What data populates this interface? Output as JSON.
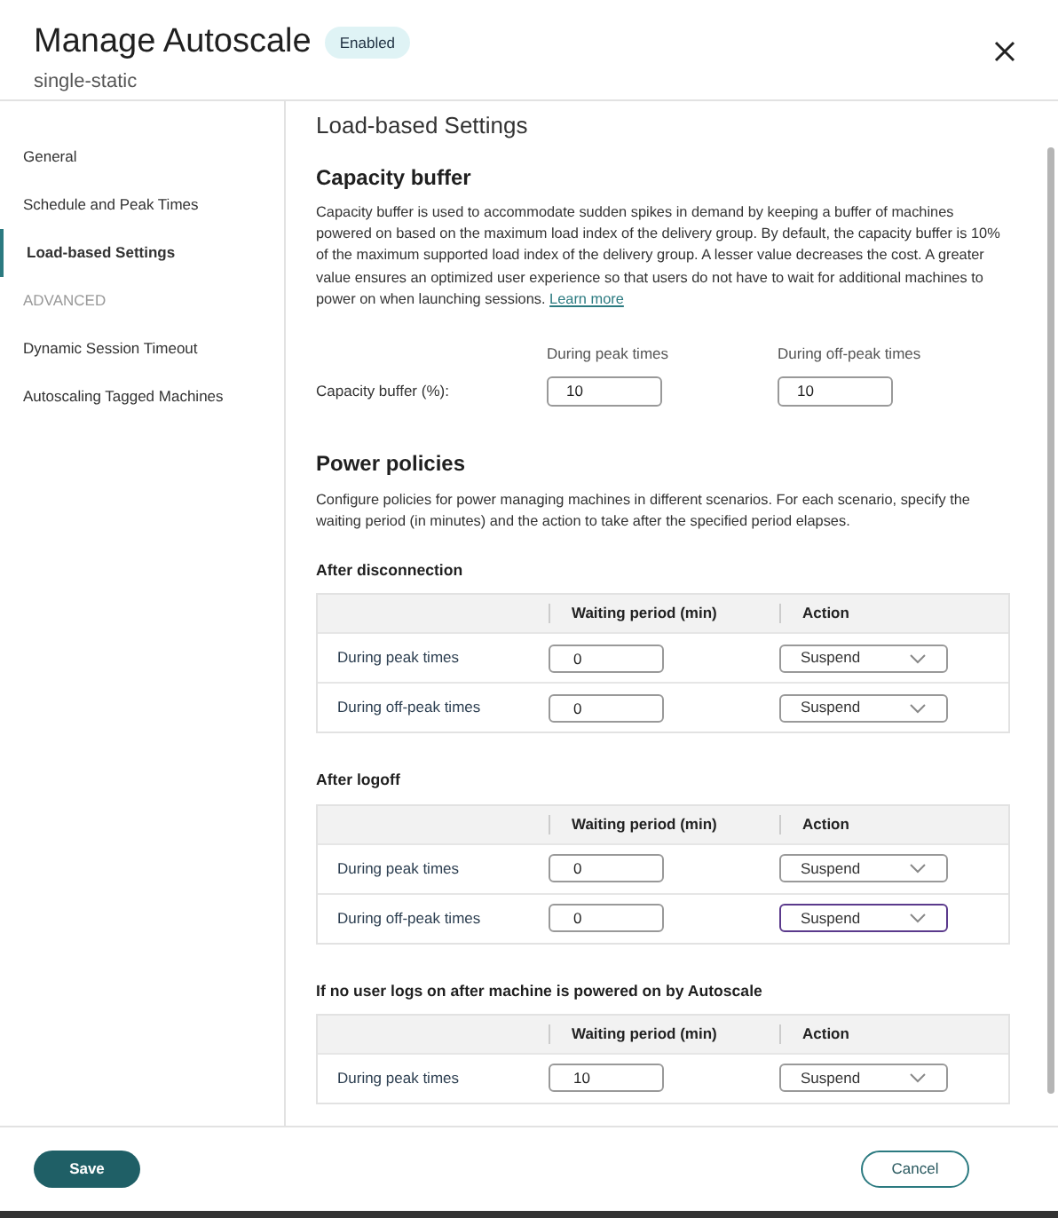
{
  "header": {
    "title": "Manage Autoscale",
    "badge": "Enabled",
    "subtitle": "single-static"
  },
  "sidebar": {
    "items": [
      {
        "label": "General",
        "kind": "link",
        "selected": false
      },
      {
        "label": "Schedule and Peak Times",
        "kind": "link",
        "selected": false
      },
      {
        "label": "Load-based Settings",
        "kind": "link",
        "selected": true
      },
      {
        "label": "ADVANCED",
        "kind": "heading",
        "selected": false
      },
      {
        "label": "Dynamic Session Timeout",
        "kind": "link",
        "selected": false
      },
      {
        "label": "Autoscaling Tagged Machines",
        "kind": "link",
        "selected": false
      }
    ]
  },
  "content": {
    "page_title": "Load-based Settings",
    "capacity_buffer": {
      "title": "Capacity buffer",
      "description": "Capacity buffer is used to accommodate sudden spikes in demand by keeping a buffer of machines powered on based on the maximum load index of the delivery group. By default, the capacity buffer is 10% of the maximum supported load index of the delivery group. A lesser value decreases the cost. A greater value ensures an optimized user experience so that users do not have to wait for additional machines to power on when launching sessions.",
      "link": "Learn more",
      "columns": [
        "During peak times",
        "During off-peak times"
      ],
      "field_label": "Capacity buffer (%):",
      "values": [
        "10",
        "10"
      ]
    },
    "power_policies": {
      "title": "Power policies",
      "description": "Configure policies for power managing machines in different scenarios. For each scenario, specify the waiting period (in minutes) and the action to take after the specified period elapses.",
      "sections": [
        {
          "title": "After disconnection",
          "columns": [
            "Waiting period (min)",
            "Action"
          ],
          "rows": [
            {
              "label": "During peak times",
              "wait": "0",
              "action": "Suspend",
              "focused": false
            },
            {
              "label": "During off-peak times",
              "wait": "0",
              "action": "Suspend",
              "focused": false
            }
          ]
        },
        {
          "title": "After logoff",
          "columns": [
            "Waiting period (min)",
            "Action"
          ],
          "rows": [
            {
              "label": "During peak times",
              "wait": "0",
              "action": "Suspend",
              "focused": false
            },
            {
              "label": "During off-peak times",
              "wait": "0",
              "action": "Suspend",
              "focused": true
            }
          ]
        },
        {
          "title": "If no user logs on after machine is powered on by Autoscale",
          "columns": [
            "Waiting period (min)",
            "Action"
          ],
          "rows": [
            {
              "label": "During peak times",
              "wait": "10",
              "action": "Suspend",
              "focused": false
            }
          ]
        }
      ]
    }
  },
  "footer": {
    "save": "Save",
    "cancel": "Cancel"
  }
}
